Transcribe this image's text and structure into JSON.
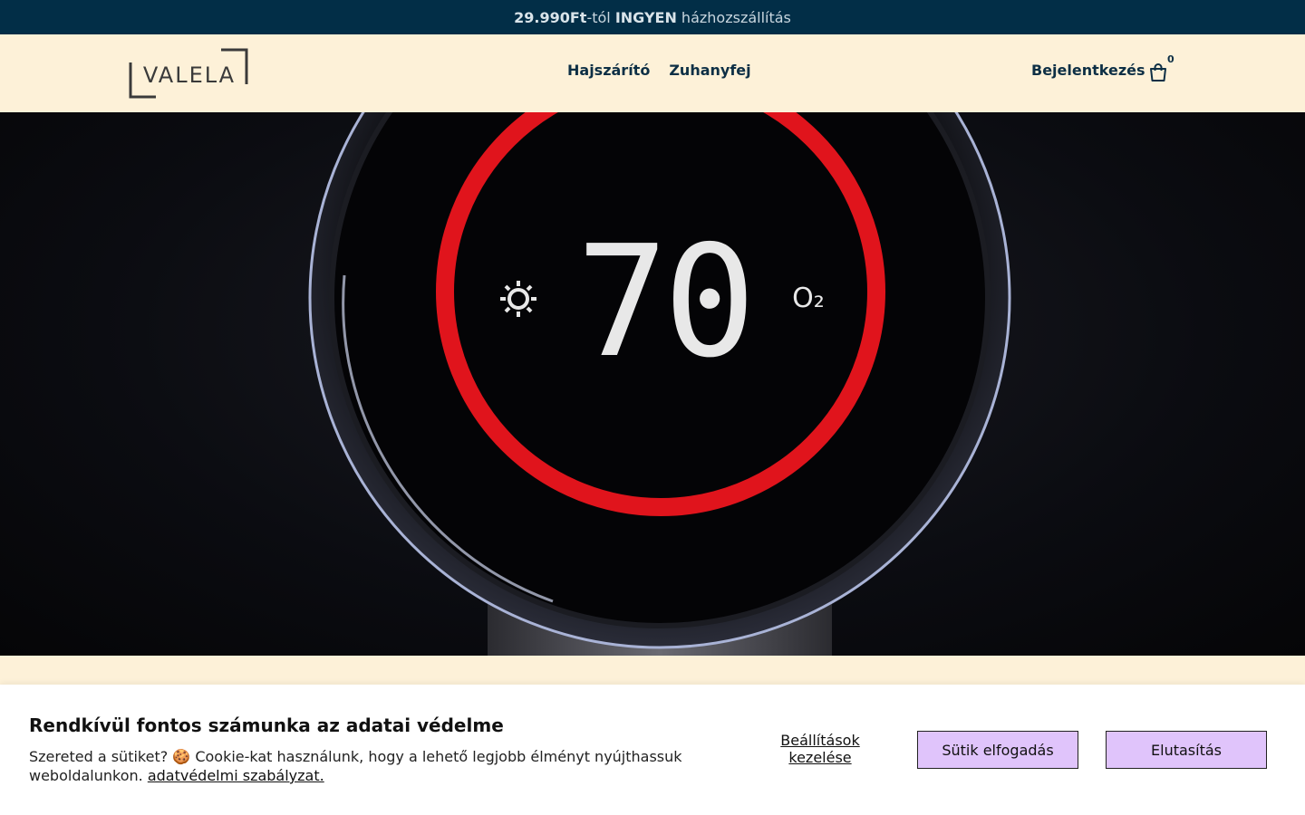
{
  "announcement": {
    "amount": "29.990Ft",
    "suffix": "-tól ",
    "free": "INGYEN",
    "shipping": " házhozszállítás"
  },
  "header": {
    "logo_text": "VALELA",
    "nav": [
      "Hajszárító",
      "Zuhanyfej"
    ],
    "login": "Bejelentkezés",
    "cart_count": "0",
    "cart_icon": "shopping-bag-icon"
  },
  "hero": {
    "display_value": "70",
    "left_icon": "sun-icon",
    "right_label": "O₂",
    "ring_color": "#e0141c"
  },
  "cookie": {
    "title": "Rendkívül fontos számunka az adatai védelme",
    "text": "Szereted a sütiket? 🍪 Cookie-kat használunk, hogy a lehető legjobb élményt nyújthassuk weboldalunkon. ",
    "link": "adatvédelmi szabályzat.",
    "manage": "Beállítások kezelése",
    "accept": "Sütik elfogadás",
    "reject": "Elutasítás"
  },
  "colors": {
    "announce_bg": "#022e47",
    "header_bg": "#fdf1d8",
    "button_bg": "#e0c4fb",
    "nav_text": "#0d2f45"
  }
}
